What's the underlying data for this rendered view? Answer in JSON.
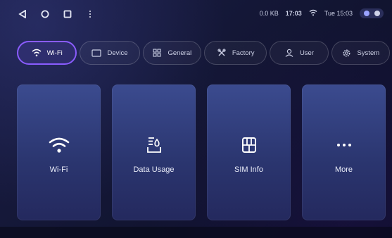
{
  "statusbar": {
    "data_rate": "0.0 KB",
    "clock": "17:03",
    "date_time": "Tue 15:03"
  },
  "tabs": [
    {
      "label": "Wi-Fi",
      "icon": "wifi-icon",
      "active": true
    },
    {
      "label": "Device",
      "icon": "device-icon",
      "active": false
    },
    {
      "label": "General",
      "icon": "grid-icon",
      "active": false
    },
    {
      "label": "Factory",
      "icon": "tools-icon",
      "active": false
    },
    {
      "label": "User",
      "icon": "user-icon",
      "active": false
    },
    {
      "label": "System",
      "icon": "gear-icon",
      "active": false
    }
  ],
  "cards": [
    {
      "label": "Wi-Fi",
      "icon": "wifi-icon"
    },
    {
      "label": "Data Usage",
      "icon": "data-usage-icon"
    },
    {
      "label": "SIM Info",
      "icon": "sim-icon"
    },
    {
      "label": "More",
      "icon": "more-icon"
    }
  ],
  "colors": {
    "accent": "#8a5cff",
    "card_top": "#3b4b8f",
    "card_bottom": "#24295e",
    "background": "#121532"
  }
}
